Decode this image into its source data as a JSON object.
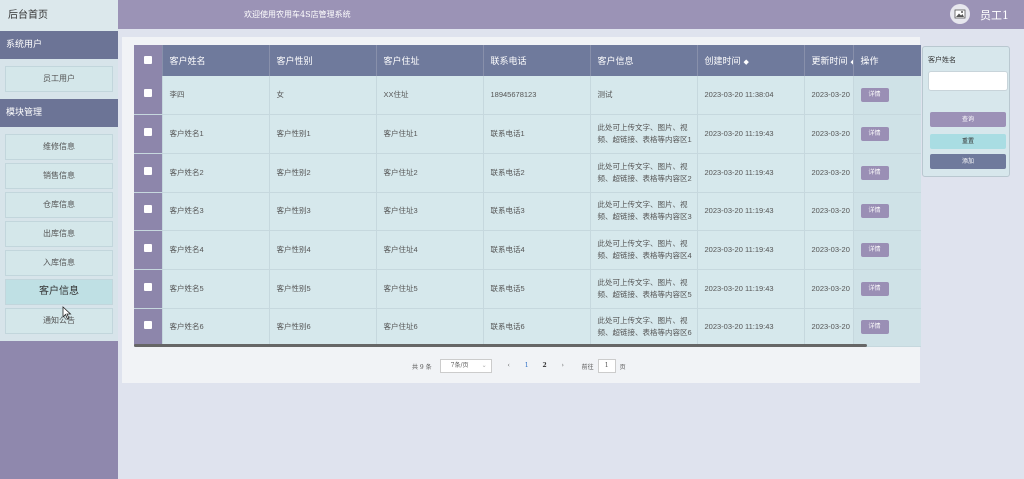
{
  "header": {
    "home": "后台首页",
    "welcome": "欢迎使用农用车4S店管理系统",
    "username": "员工1"
  },
  "sidebar": {
    "section1": "系统用户",
    "section1_items": [
      "员工用户"
    ],
    "section2": "模块管理",
    "section2_items": [
      "维修信息",
      "销售信息",
      "仓库信息",
      "出库信息",
      "入库信息",
      "客户信息",
      "通知公告"
    ],
    "active_item": "客户信息"
  },
  "table": {
    "columns": [
      "客户姓名",
      "客户性别",
      "客户住址",
      "联系电话",
      "客户信息",
      "创建时间",
      "更新时间",
      "操作"
    ],
    "rows": [
      [
        "李四",
        "女",
        "XX住址",
        "18945678123",
        "测试",
        "2023-03-20 11:38:04",
        "2023-03-20"
      ],
      [
        "客户姓名1",
        "客户性别1",
        "客户住址1",
        "联系电话1",
        "此处可上传文字、图片、视频、超链接、表格等内容区1",
        "2023-03-20 11:19:43",
        "2023-03-20"
      ],
      [
        "客户姓名2",
        "客户性别2",
        "客户住址2",
        "联系电话2",
        "此处可上传文字、图片、视频、超链接、表格等内容区2",
        "2023-03-20 11:19:43",
        "2023-03-20"
      ],
      [
        "客户姓名3",
        "客户性别3",
        "客户住址3",
        "联系电话3",
        "此处可上传文字、图片、视频、超链接、表格等内容区3",
        "2023-03-20 11:19:43",
        "2023-03-20"
      ],
      [
        "客户姓名4",
        "客户性别4",
        "客户住址4",
        "联系电话4",
        "此处可上传文字、图片、视频、超链接、表格等内容区4",
        "2023-03-20 11:19:43",
        "2023-03-20"
      ],
      [
        "客户姓名5",
        "客户性别5",
        "客户住址5",
        "联系电话5",
        "此处可上传文字、图片、视频、超链接、表格等内容区5",
        "2023-03-20 11:19:43",
        "2023-03-20"
      ],
      [
        "客户姓名6",
        "客户性别6",
        "客户住址6",
        "联系电话6",
        "此处可上传文字、图片、视频、超链接、表格等内容区6",
        "2023-03-20 11:19:43",
        "2023-03-20"
      ]
    ],
    "detail_label": "详情",
    "sort_glyph": "◆"
  },
  "pagination": {
    "total": "共 9 条",
    "page_size": "7条/页",
    "prev": "‹",
    "pages": [
      "1",
      "2"
    ],
    "next": "›",
    "goto_label": "前往",
    "goto_value": "1",
    "page_unit": "页"
  },
  "search": {
    "label": "客户姓名",
    "query_label": "查询",
    "reset_label": "重置",
    "add_label": "添加"
  },
  "colors": {
    "sidebar": "#8f88ad",
    "header": "#6f7a9c",
    "row": "#d6e8ec",
    "button": "#9a8fb5"
  }
}
